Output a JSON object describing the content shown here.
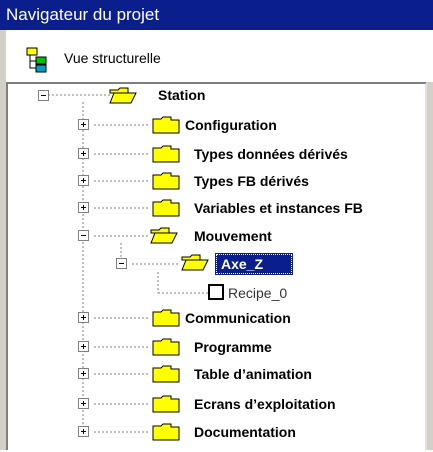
{
  "window": {
    "title": "Navigateur du projet"
  },
  "view": {
    "label": "Vue structurelle",
    "icon": "structure-view-icon"
  },
  "tree": {
    "root": {
      "label": "Station",
      "icon": "folder-open-icon"
    },
    "items": [
      {
        "label": "Configuration",
        "expander": "plus"
      },
      {
        "label": "Types données dérivés",
        "expander": "plus"
      },
      {
        "label": "Types FB dérivés",
        "expander": "plus"
      },
      {
        "label": "Variables et instances FB",
        "expander": "plus"
      },
      {
        "label": "Mouvement",
        "expander": "minus"
      },
      {
        "label": "Communication",
        "expander": "plus"
      },
      {
        "label": "Programme",
        "expander": "plus"
      },
      {
        "label": "Table d’animation",
        "expander": "plus"
      },
      {
        "label": "Ecrans d’exploitation",
        "expander": "plus"
      },
      {
        "label": "Documentation",
        "expander": "plus"
      }
    ],
    "child": {
      "label": "Axe_Z",
      "selected": true
    },
    "leaf": {
      "label": "Recipe_0"
    }
  },
  "colors": {
    "title_bar": "#0a1e8c",
    "selection": "#0a1e8c",
    "folder": "#ffff00"
  }
}
